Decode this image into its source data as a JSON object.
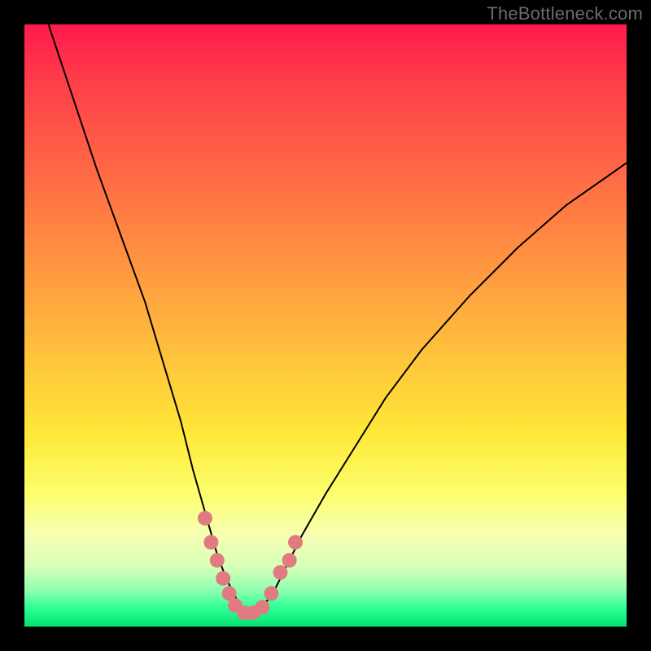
{
  "watermark": "TheBottleneck.com",
  "colors": {
    "background": "#000000",
    "curve_stroke": "#000000",
    "marker_fill": "#e07b82",
    "gradient": [
      "#ff1a4b",
      "#ff3f4a",
      "#ff6a45",
      "#ff9640",
      "#ffc23c",
      "#ffe838",
      "#fcff6e",
      "#f6ffb4",
      "#d8ffb8",
      "#8fffb0",
      "#2bff94",
      "#04e36e"
    ]
  },
  "chart_data": {
    "type": "line",
    "title": "",
    "xlabel": "",
    "ylabel": "",
    "xlim": [
      0,
      100
    ],
    "ylim": [
      0,
      100
    ],
    "series": [
      {
        "name": "curve",
        "x": [
          4,
          8,
          12,
          16,
          20,
          23,
          26,
          28,
          30,
          32,
          33.5,
          35,
          36,
          37,
          38,
          39,
          41,
          43,
          46,
          50,
          55,
          60,
          66,
          74,
          82,
          90,
          100
        ],
        "y": [
          100,
          88,
          76,
          65,
          54,
          44,
          34,
          26,
          19,
          12,
          8,
          5,
          3,
          2,
          2,
          3,
          5,
          9,
          15,
          22,
          30,
          38,
          46,
          55,
          63,
          70,
          77
        ]
      }
    ],
    "markers": {
      "name": "trough-markers",
      "points": [
        {
          "x": 30.0,
          "y": 18
        },
        {
          "x": 31.0,
          "y": 14
        },
        {
          "x": 32.0,
          "y": 11
        },
        {
          "x": 33.0,
          "y": 8
        },
        {
          "x": 34.0,
          "y": 5.5
        },
        {
          "x": 35.0,
          "y": 3.5
        },
        {
          "x": 36.5,
          "y": 2.3
        },
        {
          "x": 38.0,
          "y": 2.3
        },
        {
          "x": 39.5,
          "y": 3.2
        },
        {
          "x": 41.0,
          "y": 5.5
        },
        {
          "x": 42.5,
          "y": 9
        },
        {
          "x": 44.0,
          "y": 11
        },
        {
          "x": 45.0,
          "y": 14
        }
      ],
      "radius_px": 9
    }
  }
}
